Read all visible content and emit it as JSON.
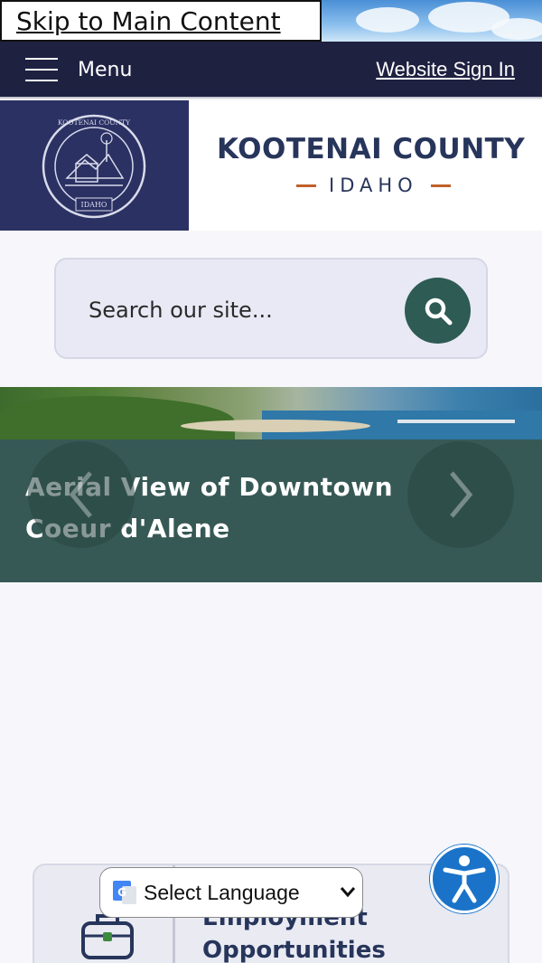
{
  "skip_link": {
    "label": "Skip to Main Content"
  },
  "navbar": {
    "menu_label": "Menu",
    "sign_in_label": "Website Sign In"
  },
  "header": {
    "county_name": "KOOTENAI COUNTY",
    "state_name": "IDAHO",
    "seal_text": "KOOTENAI COUNTY",
    "seal_state": "IDAHO"
  },
  "search": {
    "placeholder": "Search our site..."
  },
  "hero": {
    "caption": "Aerial View of Downtown Coeur d'Alene"
  },
  "quick_link": {
    "title": "Employment Opportunities"
  },
  "language": {
    "label": "Select Language"
  },
  "colors": {
    "navy": "#1f2141",
    "seal_bg": "#2b3163",
    "teal": "#2e5b53",
    "accent_orange": "#c0612b",
    "a11y_blue": "#1a73c9"
  },
  "icons": [
    "hamburger-icon",
    "search-icon",
    "chevron-left-icon",
    "chevron-right-icon",
    "briefcase-icon",
    "google-translate-icon",
    "chevron-down-icon",
    "accessibility-icon"
  ]
}
